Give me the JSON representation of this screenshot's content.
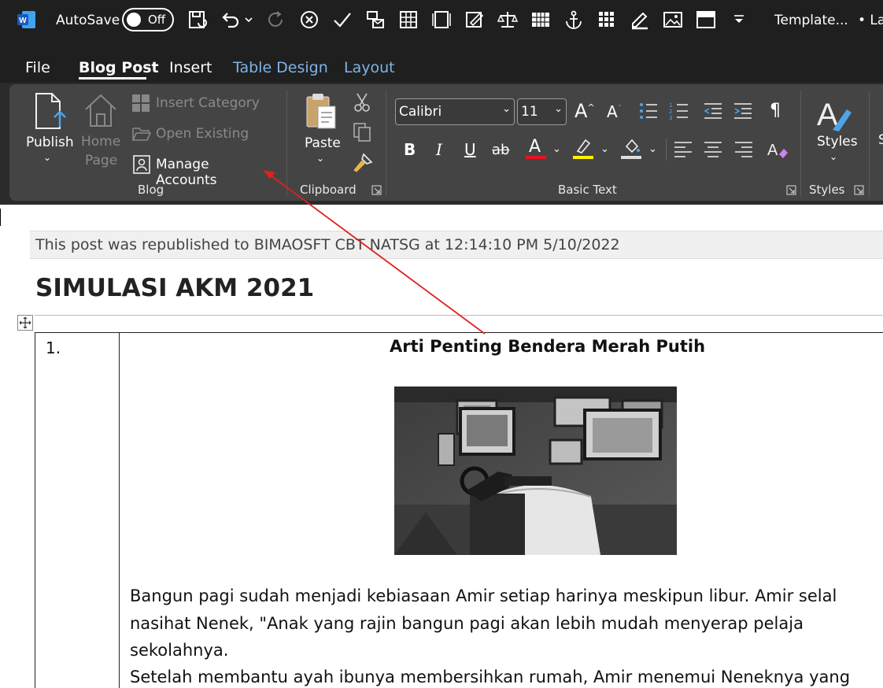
{
  "titlebar": {
    "autosave_label": "AutoSave",
    "autosave_state": "Off",
    "doc_name": "Template...",
    "overflow_text": "• Las"
  },
  "tabs": [
    {
      "label": "File"
    },
    {
      "label": "Blog Post"
    },
    {
      "label": "Insert"
    },
    {
      "label": "Table Design"
    },
    {
      "label": "Layout"
    }
  ],
  "ribbon": {
    "blog": {
      "publish": "Publish",
      "home_page_1": "Home",
      "home_page_2": "Page",
      "insert_category": "Insert Category",
      "open_existing": "Open Existing",
      "manage_accounts": "Manage Accounts",
      "group_label": "Blog"
    },
    "clipboard": {
      "paste": "Paste",
      "group_label": "Clipboard"
    },
    "basic_text": {
      "font_name": "Calibri",
      "font_size": "11",
      "bold": "B",
      "italic": "I",
      "underline": "U",
      "strike": "ab",
      "group_label": "Basic Text"
    },
    "styles": {
      "label": "Styles",
      "group_label": "Styles"
    }
  },
  "document": {
    "publish_note": "This post was republished to BIMAOSFT CBT NATSG at 12:14:10 PM 5/10/2022",
    "title": "SIMULASI AKM 2021",
    "table": {
      "row_number": "1.",
      "heading": "Arti Penting Bendera Merah Putih",
      "paragraph_lines": [
        "  Bangun pagi sudah menjadi kebiasaan Amir setiap harinya meskipun libur. Amir selal",
        "nasihat  Nenek,  \"Anak  yang  rajin  bangun  pagi  akan  lebih  mudah  menyerap  pelaja",
        "sekolahnya.",
        "  Setelah membantu ayah ibunya membersihkan rumah, Amir menemui Neneknya yang"
      ]
    }
  },
  "colors": {
    "ribbon_bg": "#444444",
    "titlebar_bg": "#1f1f1f",
    "accent_tab": "#7fb3e8",
    "annotation_arrow": "#e02020",
    "font_color_red": "#e81123",
    "highlight_yellow": "#fff200"
  }
}
